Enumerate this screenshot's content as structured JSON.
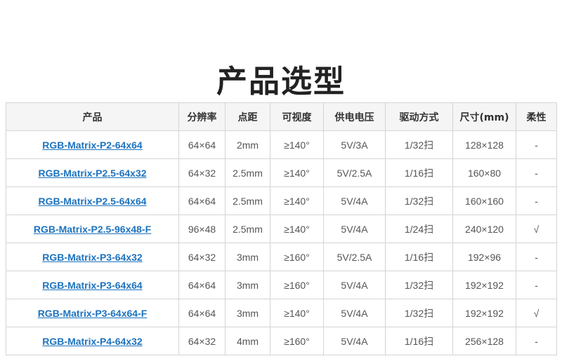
{
  "title": "产品选型",
  "headers": [
    "产品",
    "分辨率",
    "点距",
    "可视度",
    "供电电压",
    "驱动方式",
    "尺寸(mm)",
    "柔性"
  ],
  "rows": [
    {
      "product": "RGB-Matrix-P2-64x64",
      "resolution": "64×64",
      "pitch": "2mm",
      "view": "≥140°",
      "power": "5V/3A",
      "drive": "1/32扫",
      "size": "128×128",
      "flex": "-"
    },
    {
      "product": "RGB-Matrix-P2.5-64x32",
      "resolution": "64×32",
      "pitch": "2.5mm",
      "view": "≥140°",
      "power": "5V/2.5A",
      "drive": "1/16扫",
      "size": "160×80",
      "flex": "-"
    },
    {
      "product": "RGB-Matrix-P2.5-64x64",
      "resolution": "64×64",
      "pitch": "2.5mm",
      "view": "≥140°",
      "power": "5V/4A",
      "drive": "1/32扫",
      "size": "160×160",
      "flex": "-"
    },
    {
      "product": "RGB-Matrix-P2.5-96x48-F",
      "resolution": "96×48",
      "pitch": "2.5mm",
      "view": "≥140°",
      "power": "5V/4A",
      "drive": "1/24扫",
      "size": "240×120",
      "flex": "√"
    },
    {
      "product": "RGB-Matrix-P3-64x32",
      "resolution": "64×32",
      "pitch": "3mm",
      "view": "≥160°",
      "power": "5V/2.5A",
      "drive": "1/16扫",
      "size": "192×96",
      "flex": "-"
    },
    {
      "product": "RGB-Matrix-P3-64x64",
      "resolution": "64×64",
      "pitch": "3mm",
      "view": "≥160°",
      "power": "5V/4A",
      "drive": "1/32扫",
      "size": "192×192",
      "flex": "-"
    },
    {
      "product": "RGB-Matrix-P3-64x64-F",
      "resolution": "64×64",
      "pitch": "3mm",
      "view": "≥140°",
      "power": "5V/4A",
      "drive": "1/32扫",
      "size": "192×192",
      "flex": "√"
    },
    {
      "product": "RGB-Matrix-P4-64x32",
      "resolution": "64×32",
      "pitch": "4mm",
      "view": "≥160°",
      "power": "5V/4A",
      "drive": "1/16扫",
      "size": "256×128",
      "flex": "-"
    }
  ]
}
